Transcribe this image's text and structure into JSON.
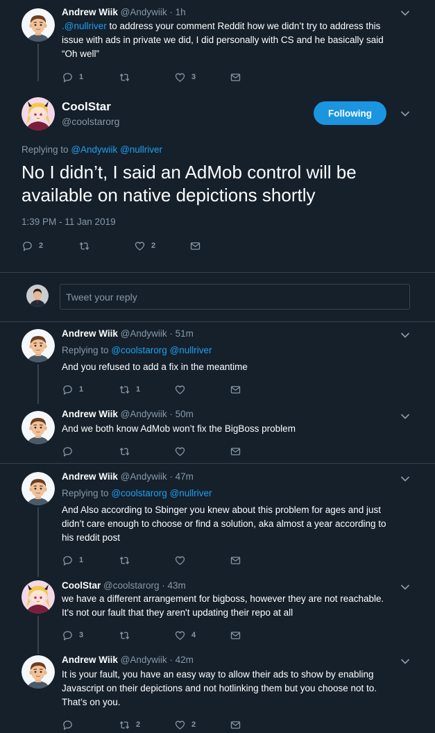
{
  "tweets": {
    "t1": {
      "name": "Andrew Wiik",
      "handle": "@Andywiik",
      "time": "· 1h",
      "mention": ".@nullriver",
      "text_line1": " to address your comment Reddit how we didn’t try to address this",
      "text_line2": "issue with ads in private we did, I did personally with CS and he basically said",
      "text_line3": "“Oh well”",
      "replies": "1",
      "retweets": "",
      "likes": "3"
    },
    "main": {
      "name": "CoolStar",
      "handle": "@coolstarorg",
      "follow_label": "Following",
      "replying_label": "Replying to",
      "reply_to1": "@Andywiik",
      "reply_to2": "@nullriver",
      "text_line1": "No I didn’t, I said an AdMob control will be",
      "text_line2": "available on native depictions shortly",
      "timestamp": "1:39 PM - 11 Jan 2019",
      "replies": "2",
      "retweets": "",
      "likes": "2"
    },
    "t2": {
      "name": "Andrew Wiik",
      "handle": "@Andywiik",
      "time": "· 51m",
      "replying_label": "Replying to",
      "reply_to1": "@coolstarorg",
      "reply_to2": "@nullriver",
      "text": "And you refused to add a fix in the meantime",
      "replies": "1",
      "retweets": "1",
      "likes": ""
    },
    "t3": {
      "name": "Andrew Wiik",
      "handle": "@Andywiik",
      "time": "· 50m",
      "text": "And we both know AdMob won’t fix the BigBoss problem",
      "replies": "",
      "retweets": "",
      "likes": ""
    },
    "t4": {
      "name": "Andrew Wiik",
      "handle": "@Andywiik",
      "time": "· 47m",
      "replying_label": "Replying to",
      "reply_to1": "@coolstarorg",
      "reply_to2": "@nullriver",
      "text_line1": "And Also according to Sbinger you knew about this problem for ages and just",
      "text_line2": "didn’t care enough to choose or find a solution, aka almost a year according to",
      "text_line3": "his reddit post",
      "replies": "1",
      "retweets": "",
      "likes": ""
    },
    "t5": {
      "name": "CoolStar",
      "handle": "@coolstarorg",
      "time": "· 43m",
      "text_line1": "we have a different arrangement for bigboss, however they are not reachable.",
      "text_line2": "It's not our fault that they aren't updating their repo at all",
      "replies": "3",
      "retweets": "",
      "likes": "4"
    },
    "t6": {
      "name": "Andrew Wiik",
      "handle": "@Andywiik",
      "time": "· 42m",
      "text_line1": "It is your fault, you have an easy way to allow their ads to show by enabling",
      "text_line2": "Javascript on their depictions and not hotlinking them but you choose not to.",
      "text_line3": "That’s on you.",
      "replies": "",
      "retweets": "2",
      "likes": "2"
    }
  },
  "reply_box": {
    "placeholder": "Tweet your reply"
  },
  "icons": {
    "reply": "reply-icon",
    "retweet": "retweet-icon",
    "like": "heart-icon",
    "dm": "envelope-icon",
    "more": "chevron-down-icon"
  },
  "colors": {
    "background": "#15202b",
    "link": "#1da1f2",
    "muted": "#8899a6",
    "divider": "#38444d",
    "button": "#1b95e0"
  }
}
